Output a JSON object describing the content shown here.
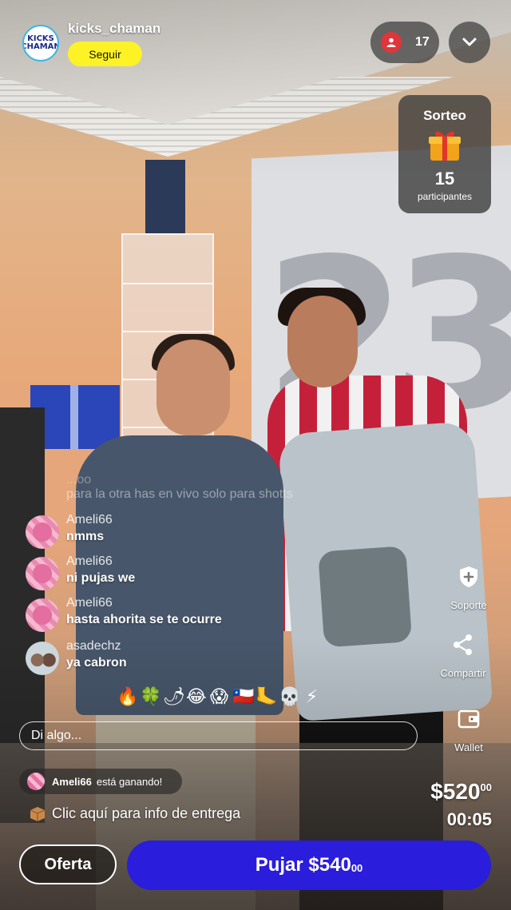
{
  "header": {
    "avatar_text": "KICKS CHAMAN",
    "username": "kicks_chaman",
    "follow_label": "Seguir",
    "viewer_count": "17"
  },
  "giveaway": {
    "title": "Sorteo",
    "count": "15",
    "label": "participantes"
  },
  "chat": {
    "faded_user": "...oo",
    "faded_text": "para la otra has en vivo solo para shotts",
    "messages": [
      {
        "user": "Ameli66",
        "text": "nmms"
      },
      {
        "user": "Ameli66",
        "text": "ni pujas we"
      },
      {
        "user": "Ameli66",
        "text": "hasta ahorita  se te ocurre"
      },
      {
        "user": "asadechz",
        "text": "ya cabron"
      }
    ],
    "reactions": [
      "🔥",
      "🍀",
      "🌶",
      "😂",
      "😱",
      "🇨🇱",
      "🦶",
      "💀",
      "⚡"
    ],
    "input_placeholder": "Di algo..."
  },
  "winning": {
    "user": "Ameli66",
    "text": "está ganando!"
  },
  "delivery": {
    "text": "Clic aquí para info de entrega"
  },
  "side_actions": {
    "support_label": "Soporte",
    "share_label": "Compartir",
    "wallet_label": "Wallet"
  },
  "auction": {
    "price_main": "$520",
    "price_cents": "00",
    "timer": "00:05",
    "offer_label": "Oferta",
    "bid_label": "Pujar $540",
    "bid_cents": "00"
  },
  "colors": {
    "follow_button": "#fdf226",
    "bid_button": "#2a1ddb",
    "viewer_icon": "#e0353a"
  }
}
